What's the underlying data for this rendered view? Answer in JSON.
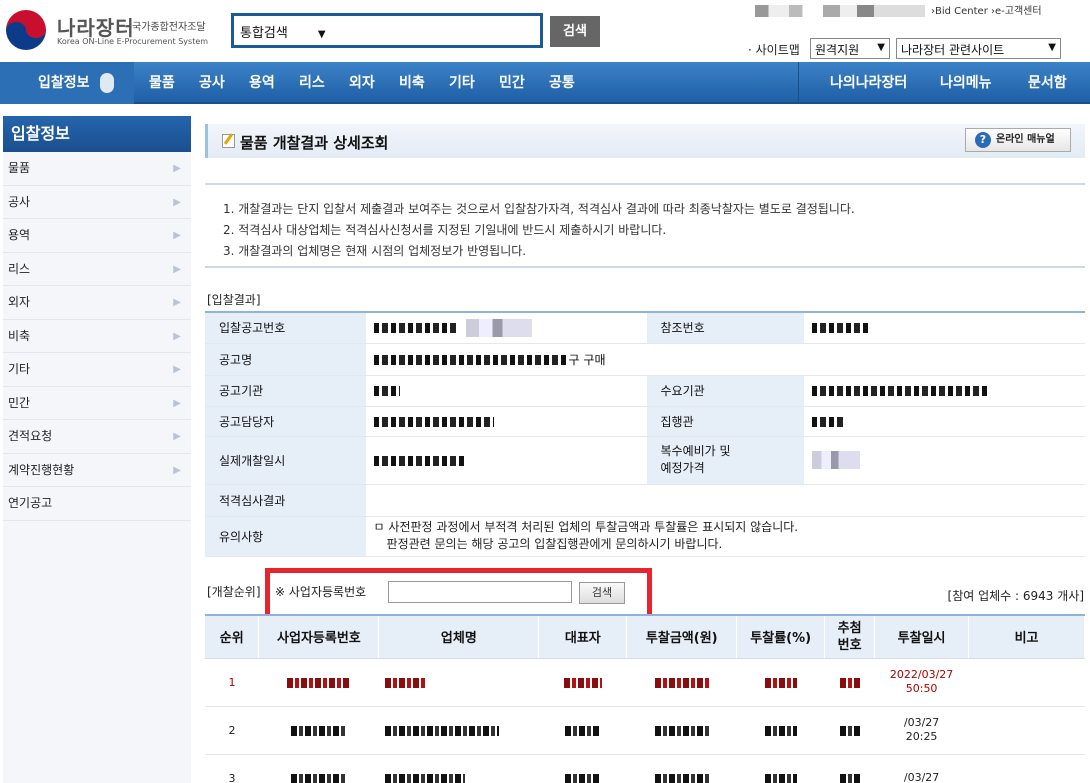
{
  "header": {
    "brand_title": "나라장터",
    "brand_sub_ko": "국가종합전자조달",
    "brand_sub_en": "Korea ON-Line E-Procurement System",
    "search_scope": "통합검색",
    "search_button": "검색",
    "util_links": "›Bid Center  ›e-고객센터",
    "sitemap_label": "· 사이트맵",
    "remote_support": "원격지원",
    "related_sites": "나라장터 관련사이트"
  },
  "nav": {
    "home": "입찰정보",
    "items": [
      "물품",
      "공사",
      "용역",
      "리스",
      "외자",
      "비축",
      "기타",
      "민간",
      "공통"
    ],
    "right": [
      "나의나라장터",
      "나의메뉴",
      "문서함"
    ]
  },
  "sidebar": {
    "title": "입찰정보",
    "items": [
      "물품",
      "공사",
      "용역",
      "리스",
      "외자",
      "비축",
      "기타",
      "민간",
      "견적요청",
      "계약진행현황",
      "연기공고"
    ]
  },
  "page": {
    "title": "물품 개찰결과 상세조회",
    "manual": "온라인 매뉴얼",
    "notices": [
      "1. 개찰결과는 단지 입찰서 제출결과 보여주는 것으로서 입찰참가자격, 적격심사 결과에 따라 최종낙찰자는 별도로 결정됩니다.",
      "2. 적격심사 대상업체는 적격심사신청서를 지정된 기일내에 반드시 제출하시기 바랍니다.",
      "3. 개찰결과의 업체명은 현재 시점의 업체정보가 반영됩니다."
    ]
  },
  "bid_result": {
    "section": "[입찰결과]",
    "labels": {
      "notice_no": "입찰공고번호",
      "ref_no": "참조번호",
      "notice_name": "공고명",
      "notice_name_suffix": "구 구매",
      "notice_org": "공고기관",
      "demand_org": "수요기관",
      "officer": "공고담당자",
      "executor": "집행관",
      "open_date": "실제개찰일시",
      "multi_price": "복수예비가 및\n예정가격",
      "eligibility": "적격심사결과",
      "caution": "유의사항"
    },
    "caution_text_1": "ㅁ 사전판정 과정에서 부적격 처리된 업체의 투찰금액과 투찰률은 표시되지 않습니다.",
    "caution_text_2": "판정관련 문의는 해당 공고의 입찰집행관에게 문의하시기 바랍니다."
  },
  "ranking": {
    "section": "[개찰순위]",
    "bizno_label": "※ 사업자등록번호",
    "bizno_value": "",
    "search_btn": "검색",
    "count_text": "[참여 업체수 : 6943 개사]",
    "columns": [
      "순위",
      "사업자등록번호",
      "업체명",
      "대표자",
      "투찰금액(원)",
      "투찰률(%)",
      "추첨\n번호",
      "투찰일시",
      "비고"
    ],
    "rows": [
      {
        "rank": "1",
        "date_top": "2022/03/27",
        "date_bottom": "50:50"
      },
      {
        "rank": "2",
        "date_top": "/03/27",
        "date_bottom": "20:25"
      },
      {
        "rank": "3",
        "date_top": "/03/27",
        "date_bottom": ""
      }
    ]
  },
  "colors": {
    "nav": "#2d6fb5",
    "highlight": "#e8242c",
    "label_bg": "#e6eef8"
  }
}
